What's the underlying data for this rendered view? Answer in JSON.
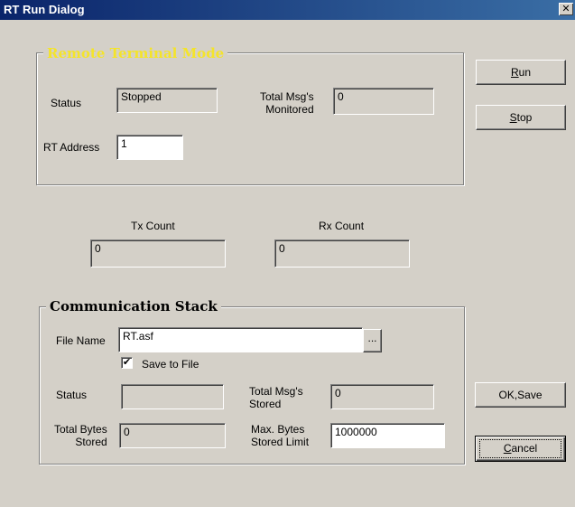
{
  "window": {
    "title": "RT Run Dialog",
    "close_glyph": "✕"
  },
  "rt_group": {
    "legend": "Remote Terminal Mode",
    "status_label": "Status",
    "status_value": "Stopped",
    "total_msgs_label_1": "Total Msg's",
    "total_msgs_label_2": "Monitored",
    "total_msgs_value": "0",
    "rt_address_label": "RT Address",
    "rt_address_value": "1"
  },
  "counts": {
    "tx_label": "Tx Count",
    "tx_value": "0",
    "rx_label": "Rx Count",
    "rx_value": "0"
  },
  "stack_group": {
    "legend": "Communication Stack",
    "file_name_label": "File Name",
    "file_name_value": "RT.asf",
    "browse_label": "...",
    "save_to_file_label": "Save to File",
    "save_to_file_checked": true,
    "status_label": "Status",
    "status_value": "",
    "total_msgs_label_1": "Total Msg's",
    "total_msgs_label_2": "Stored",
    "total_msgs_value": "0",
    "total_bytes_label_1": "Total Bytes",
    "total_bytes_label_2": "Stored",
    "total_bytes_value": "0",
    "max_bytes_label_1": "Max. Bytes",
    "max_bytes_label_2": "Stored Limit",
    "max_bytes_value": "1000000"
  },
  "buttons": {
    "run_mnemonic": "R",
    "run_rest": "un",
    "stop_mnemonic": "S",
    "stop_rest": "top",
    "ok_save": "OK,Save",
    "cancel_mnemonic": "C",
    "cancel_rest": "ancel"
  },
  "colors": {
    "titlebar": "#0a246a",
    "legend_remote": "#f4e42a",
    "face": "#d4d0c8"
  }
}
